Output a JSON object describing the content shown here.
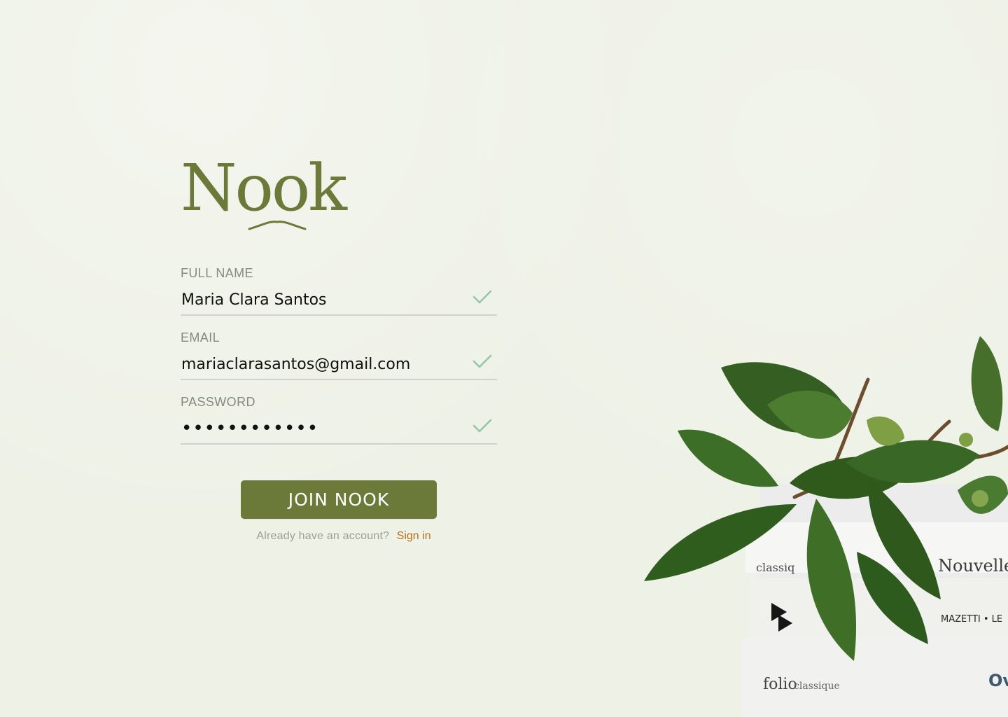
{
  "brand": {
    "name": "Nook",
    "accent": "#6b7a39",
    "link": "#b86e1c"
  },
  "form": {
    "full_name": {
      "label": "FULL NAME",
      "value": "Maria Clara Santos",
      "valid": true
    },
    "email": {
      "label": "EMAIL",
      "value": "mariaclarasantos@gmail.com",
      "valid": true
    },
    "password": {
      "label": "PASSWORD",
      "value": "••••••••••••",
      "valid": true
    },
    "submit_label": "JOIN NOOK",
    "signin_prompt": "Already have an account?",
    "signin_link": "Sign in"
  },
  "decor": {
    "book_titles": [
      "classiq",
      "Nouvelles",
      "MAZETTI • LE",
      "folio",
      "classique",
      "Ov"
    ],
    "description_icon": "plant-and-books-icon"
  }
}
